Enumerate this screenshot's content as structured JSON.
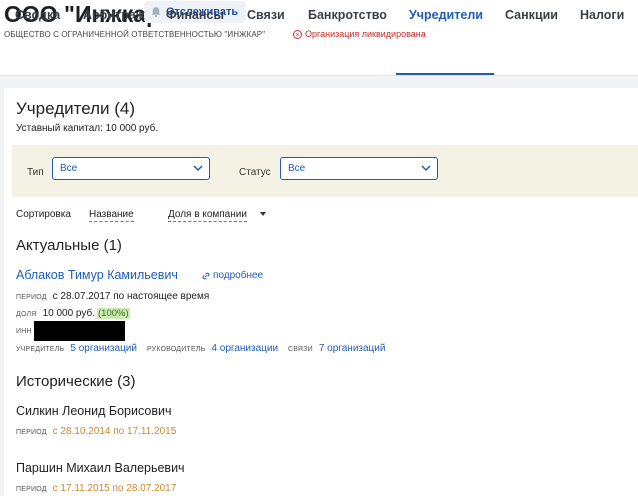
{
  "header": {
    "company_title": "ООО \"Инжкар\"",
    "follow_label": "Отслеживать",
    "full_name": "ОБЩЕСТВО С ОГРАНИЧЕННОЙ ОТВЕТСТВЕННОСТЬЮ \"ИНЖКАР\"",
    "status": "Организация ликвидирована"
  },
  "tabs": [
    {
      "label": "Сводка"
    },
    {
      "label": "Арбитраж"
    },
    {
      "label": "Финансы"
    },
    {
      "label": "Связи"
    },
    {
      "label": "Банкротство"
    },
    {
      "label": "Учредители",
      "active": true
    },
    {
      "label": "Санкции"
    },
    {
      "label": "Налоги"
    }
  ],
  "main": {
    "title": "Учредители (4)",
    "capital": "Уставный капитал: 10 000 руб.",
    "filters": {
      "type_label": "Тип",
      "type_value": "Все",
      "status_label": "Статус",
      "status_value": "Все"
    },
    "sort": {
      "label": "Сортировка",
      "by_name": "Название",
      "by_share": "Доля в компании"
    },
    "current": {
      "heading": "Актуальные (1)",
      "person": {
        "name": "Аблаков Тимур Камильевич",
        "more": "подробнее",
        "period_label": "период",
        "period": "с 28.07.2017 по настоящее время",
        "share_label": "доля",
        "share_value": "10 000 руб.",
        "share_pct": "(100%)",
        "inn_label": "инн",
        "founder_label": "учредитель",
        "founder_link": "5 организаций",
        "manager_label": "руководитель",
        "manager_link": "4 организации",
        "links_label": "связи",
        "links_link": "7 организаций"
      }
    },
    "historical": {
      "heading": "Исторические (3)",
      "people": [
        {
          "name": "Силкин Леонид Борисович",
          "period_label": "период",
          "period": "с 28.10.2014 по 17.11.2015"
        },
        {
          "name": "Паршин Михаил Валерьевич",
          "period_label": "период",
          "period": "с 17.11.2015 по 28.07.2017"
        }
      ]
    }
  },
  "colors": {
    "accent": "#1f5cb8",
    "danger": "#c62828",
    "historical_period": "#d0882a",
    "filter_bg": "#f3f2e4",
    "share_badge": "#cdeab5"
  },
  "icons": {
    "follow": "bell-icon",
    "status": "close-circle-icon",
    "more": "link-icon",
    "select": "chevron-down-icon"
  }
}
